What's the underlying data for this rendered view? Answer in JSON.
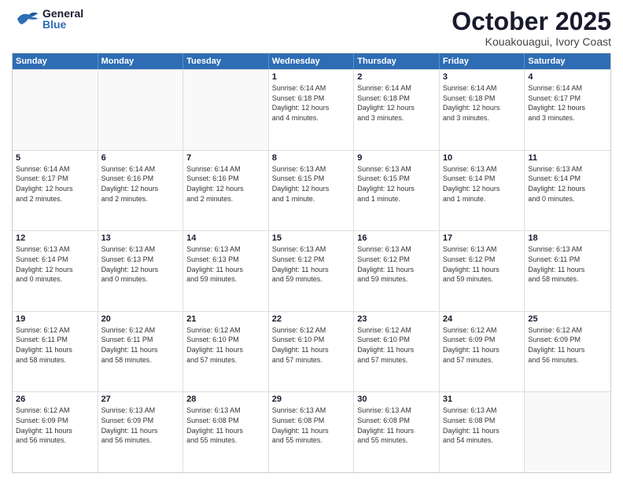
{
  "header": {
    "logo_general": "General",
    "logo_blue": "Blue",
    "month_title": "October 2025",
    "location": "Kouakouagui, Ivory Coast"
  },
  "calendar": {
    "days_of_week": [
      "Sunday",
      "Monday",
      "Tuesday",
      "Wednesday",
      "Thursday",
      "Friday",
      "Saturday"
    ],
    "weeks": [
      [
        {
          "day": "",
          "lines": []
        },
        {
          "day": "",
          "lines": []
        },
        {
          "day": "",
          "lines": []
        },
        {
          "day": "1",
          "lines": [
            "Sunrise: 6:14 AM",
            "Sunset: 6:18 PM",
            "Daylight: 12 hours",
            "and 4 minutes."
          ]
        },
        {
          "day": "2",
          "lines": [
            "Sunrise: 6:14 AM",
            "Sunset: 6:18 PM",
            "Daylight: 12 hours",
            "and 3 minutes."
          ]
        },
        {
          "day": "3",
          "lines": [
            "Sunrise: 6:14 AM",
            "Sunset: 6:18 PM",
            "Daylight: 12 hours",
            "and 3 minutes."
          ]
        },
        {
          "day": "4",
          "lines": [
            "Sunrise: 6:14 AM",
            "Sunset: 6:17 PM",
            "Daylight: 12 hours",
            "and 3 minutes."
          ]
        }
      ],
      [
        {
          "day": "5",
          "lines": [
            "Sunrise: 6:14 AM",
            "Sunset: 6:17 PM",
            "Daylight: 12 hours",
            "and 2 minutes."
          ]
        },
        {
          "day": "6",
          "lines": [
            "Sunrise: 6:14 AM",
            "Sunset: 6:16 PM",
            "Daylight: 12 hours",
            "and 2 minutes."
          ]
        },
        {
          "day": "7",
          "lines": [
            "Sunrise: 6:14 AM",
            "Sunset: 6:16 PM",
            "Daylight: 12 hours",
            "and 2 minutes."
          ]
        },
        {
          "day": "8",
          "lines": [
            "Sunrise: 6:13 AM",
            "Sunset: 6:15 PM",
            "Daylight: 12 hours",
            "and 1 minute."
          ]
        },
        {
          "day": "9",
          "lines": [
            "Sunrise: 6:13 AM",
            "Sunset: 6:15 PM",
            "Daylight: 12 hours",
            "and 1 minute."
          ]
        },
        {
          "day": "10",
          "lines": [
            "Sunrise: 6:13 AM",
            "Sunset: 6:14 PM",
            "Daylight: 12 hours",
            "and 1 minute."
          ]
        },
        {
          "day": "11",
          "lines": [
            "Sunrise: 6:13 AM",
            "Sunset: 6:14 PM",
            "Daylight: 12 hours",
            "and 0 minutes."
          ]
        }
      ],
      [
        {
          "day": "12",
          "lines": [
            "Sunrise: 6:13 AM",
            "Sunset: 6:14 PM",
            "Daylight: 12 hours",
            "and 0 minutes."
          ]
        },
        {
          "day": "13",
          "lines": [
            "Sunrise: 6:13 AM",
            "Sunset: 6:13 PM",
            "Daylight: 12 hours",
            "and 0 minutes."
          ]
        },
        {
          "day": "14",
          "lines": [
            "Sunrise: 6:13 AM",
            "Sunset: 6:13 PM",
            "Daylight: 11 hours",
            "and 59 minutes."
          ]
        },
        {
          "day": "15",
          "lines": [
            "Sunrise: 6:13 AM",
            "Sunset: 6:12 PM",
            "Daylight: 11 hours",
            "and 59 minutes."
          ]
        },
        {
          "day": "16",
          "lines": [
            "Sunrise: 6:13 AM",
            "Sunset: 6:12 PM",
            "Daylight: 11 hours",
            "and 59 minutes."
          ]
        },
        {
          "day": "17",
          "lines": [
            "Sunrise: 6:13 AM",
            "Sunset: 6:12 PM",
            "Daylight: 11 hours",
            "and 59 minutes."
          ]
        },
        {
          "day": "18",
          "lines": [
            "Sunrise: 6:13 AM",
            "Sunset: 6:11 PM",
            "Daylight: 11 hours",
            "and 58 minutes."
          ]
        }
      ],
      [
        {
          "day": "19",
          "lines": [
            "Sunrise: 6:12 AM",
            "Sunset: 6:11 PM",
            "Daylight: 11 hours",
            "and 58 minutes."
          ]
        },
        {
          "day": "20",
          "lines": [
            "Sunrise: 6:12 AM",
            "Sunset: 6:11 PM",
            "Daylight: 11 hours",
            "and 58 minutes."
          ]
        },
        {
          "day": "21",
          "lines": [
            "Sunrise: 6:12 AM",
            "Sunset: 6:10 PM",
            "Daylight: 11 hours",
            "and 57 minutes."
          ]
        },
        {
          "day": "22",
          "lines": [
            "Sunrise: 6:12 AM",
            "Sunset: 6:10 PM",
            "Daylight: 11 hours",
            "and 57 minutes."
          ]
        },
        {
          "day": "23",
          "lines": [
            "Sunrise: 6:12 AM",
            "Sunset: 6:10 PM",
            "Daylight: 11 hours",
            "and 57 minutes."
          ]
        },
        {
          "day": "24",
          "lines": [
            "Sunrise: 6:12 AM",
            "Sunset: 6:09 PM",
            "Daylight: 11 hours",
            "and 57 minutes."
          ]
        },
        {
          "day": "25",
          "lines": [
            "Sunrise: 6:12 AM",
            "Sunset: 6:09 PM",
            "Daylight: 11 hours",
            "and 56 minutes."
          ]
        }
      ],
      [
        {
          "day": "26",
          "lines": [
            "Sunrise: 6:12 AM",
            "Sunset: 6:09 PM",
            "Daylight: 11 hours",
            "and 56 minutes."
          ]
        },
        {
          "day": "27",
          "lines": [
            "Sunrise: 6:13 AM",
            "Sunset: 6:09 PM",
            "Daylight: 11 hours",
            "and 56 minutes."
          ]
        },
        {
          "day": "28",
          "lines": [
            "Sunrise: 6:13 AM",
            "Sunset: 6:08 PM",
            "Daylight: 11 hours",
            "and 55 minutes."
          ]
        },
        {
          "day": "29",
          "lines": [
            "Sunrise: 6:13 AM",
            "Sunset: 6:08 PM",
            "Daylight: 11 hours",
            "and 55 minutes."
          ]
        },
        {
          "day": "30",
          "lines": [
            "Sunrise: 6:13 AM",
            "Sunset: 6:08 PM",
            "Daylight: 11 hours",
            "and 55 minutes."
          ]
        },
        {
          "day": "31",
          "lines": [
            "Sunrise: 6:13 AM",
            "Sunset: 6:08 PM",
            "Daylight: 11 hours",
            "and 54 minutes."
          ]
        },
        {
          "day": "",
          "lines": []
        }
      ]
    ]
  }
}
